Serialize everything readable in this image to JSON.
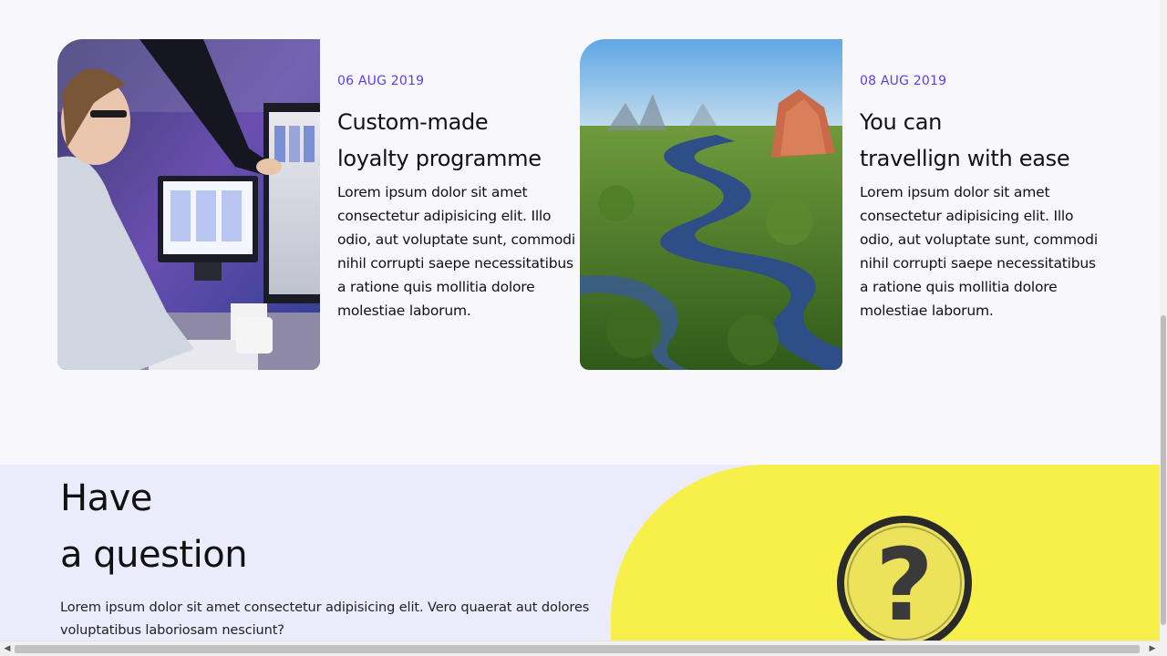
{
  "cards": [
    {
      "date": "06 AUG 2019",
      "title_line1": "Custom-made",
      "title_line2": "loyalty programme",
      "text": "Lorem ipsum dolor sit amet consectetur adipisicing elit. Illo odio, aut voluptate sunt, commodi nihil corrupti saepe necessitatibus a ratione quis mollitia dolore molestiae laborum.",
      "image": "designer-at-computer-photo"
    },
    {
      "date": "08 AUG 2019",
      "title_line1": "You can",
      "title_line2": "travellign with ease",
      "text": "Lorem ipsum dolor sit amet consectetur adipisicing elit. Illo odio, aut voluptate sunt, commodi nihil corrupti saepe necessitatibus a ratione quis mollitia dolore molestiae laborum.",
      "image": "river-landscape-photo"
    }
  ],
  "question": {
    "title_line1": "Have",
    "title_line2": "a question",
    "text": "Lorem ipsum dolor sit amet consectetur adipisicing elit. Vero quaerat aut dolores voluptatibus laboriosam nesciunt?",
    "image": "magnifier-question-mark-photo",
    "accent": "#f8f04a"
  },
  "colors": {
    "date": "#5b3df5",
    "page_bg": "#f8f7fb",
    "question_bg": "#ebebfb"
  },
  "scrollbar": {
    "left_arrow": "◀",
    "right_arrow": "▶"
  }
}
